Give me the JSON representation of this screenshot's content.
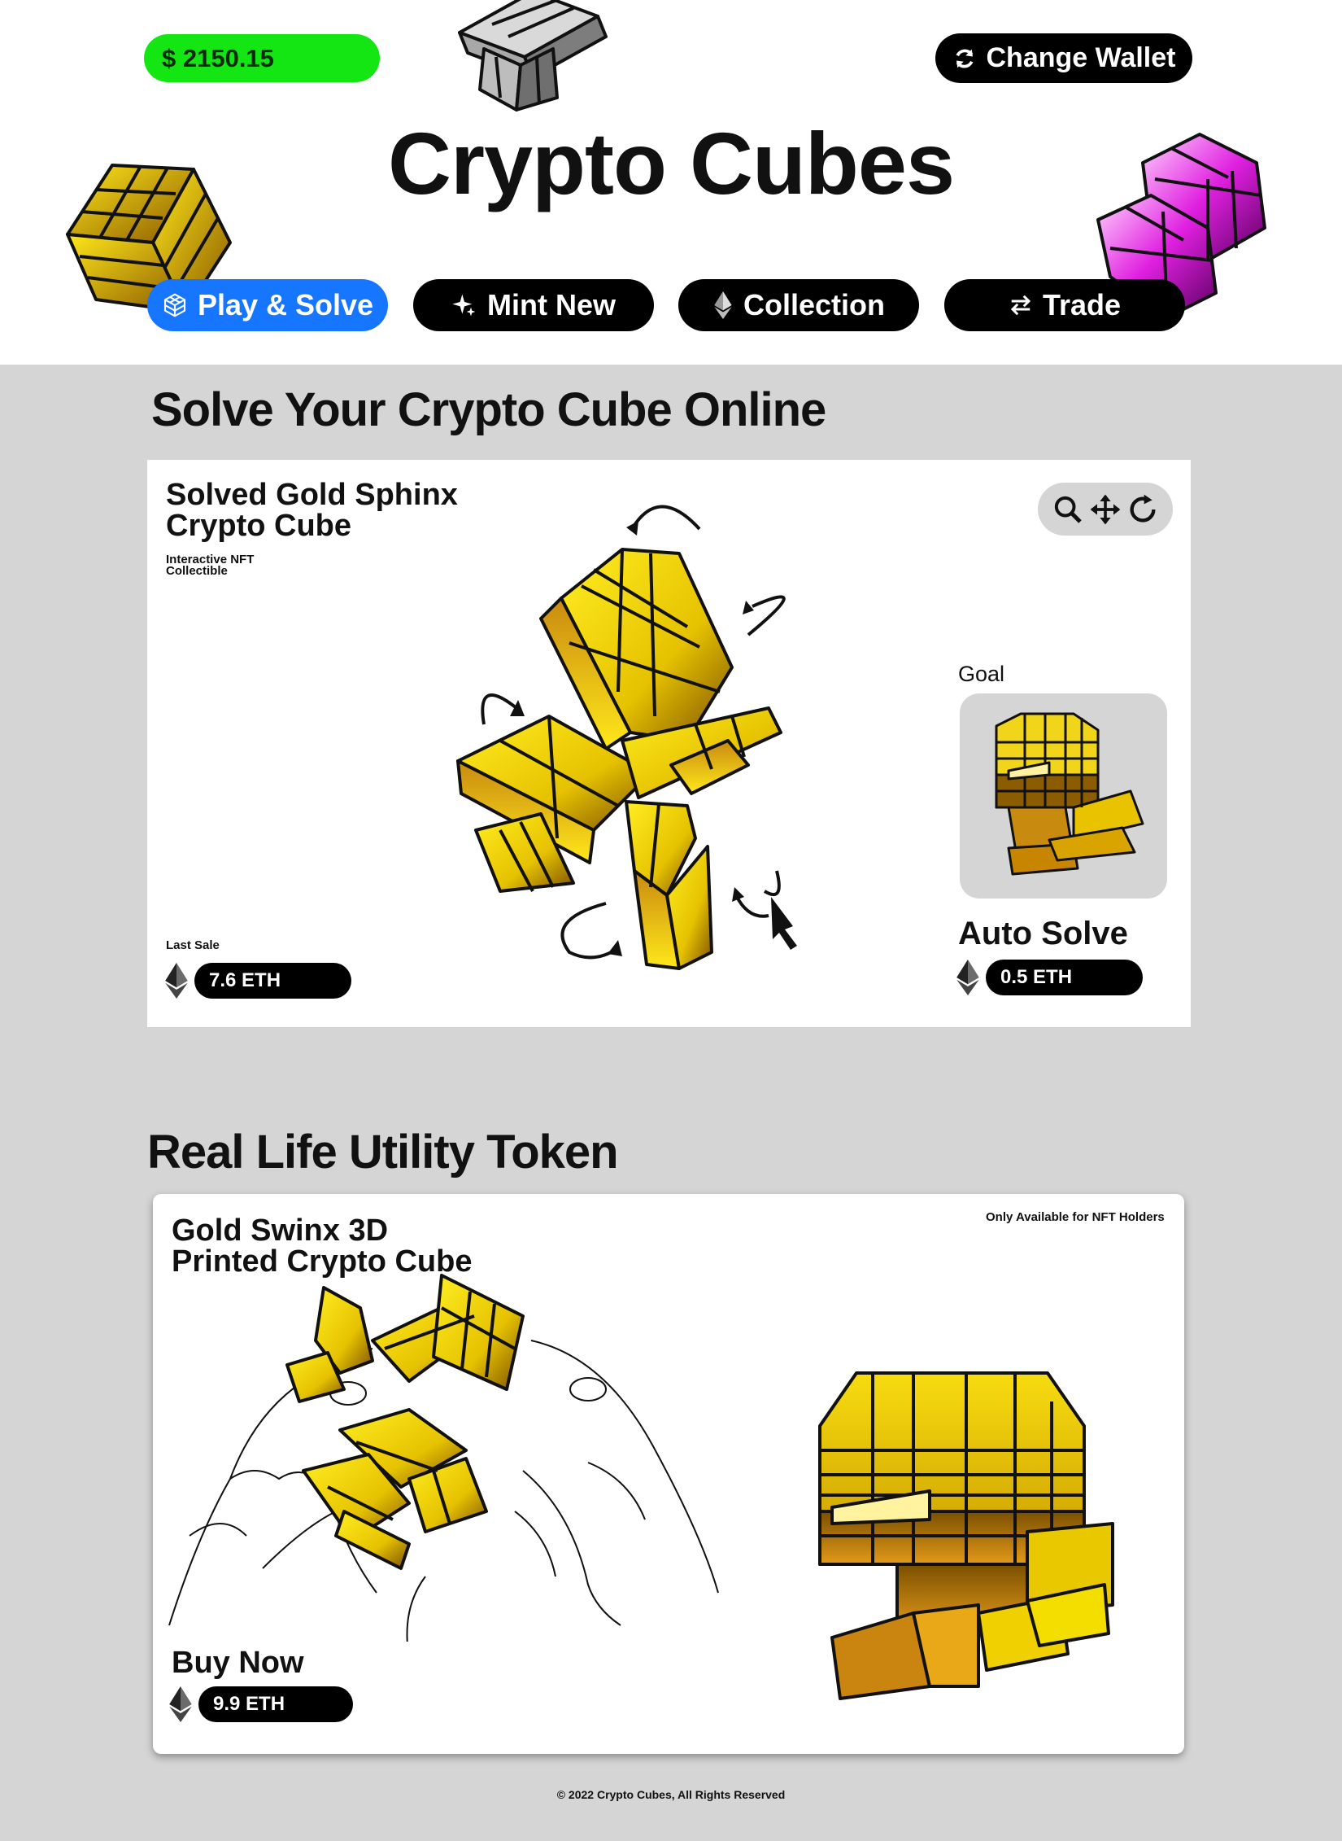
{
  "header": {
    "balance": "$ 2150.15",
    "wallet_button": "Change Wallet",
    "title": "Crypto Cubes"
  },
  "nav": [
    {
      "label": "Play & Solve",
      "icon": "cube-grid-icon",
      "active": true
    },
    {
      "label": "Mint New",
      "icon": "sparkle-icon",
      "active": false
    },
    {
      "label": "Collection",
      "icon": "ethereum-icon",
      "active": false
    },
    {
      "label": "Trade",
      "icon": "swap-arrows-icon",
      "active": false
    }
  ],
  "solve_section": {
    "heading": "Solve Your Crypto Cube Online",
    "card_title_line1": "Solved Gold Sphinx",
    "card_title_line2": "Crypto Cube",
    "subtitle_line1": "Interactive NFT",
    "subtitle_line2": "Collectible",
    "tools": [
      "zoom-icon",
      "move-icon",
      "rotate-icon"
    ],
    "last_sale_label": "Last Sale",
    "last_sale_price": "7.6 ETH",
    "goal_label": "Goal",
    "auto_solve_label": "Auto Solve",
    "auto_solve_price": "0.5 ETH"
  },
  "utility_section": {
    "heading": "Real Life Utility Token",
    "card_title_line1": "Gold Swinx 3D",
    "card_title_line2": "Printed Crypto Cube",
    "note": "Only Available for NFT Holders",
    "buy_label": "Buy Now",
    "buy_price": "9.9 ETH"
  },
  "footer": "© 2022 Crypto Cubes, All Rights Reserved",
  "colors": {
    "accent_green": "#14e614",
    "accent_blue": "#1676ff",
    "gold": "#f2d60a",
    "magenta": "#d81fd8",
    "panel_grey": "#d5d5d5"
  }
}
